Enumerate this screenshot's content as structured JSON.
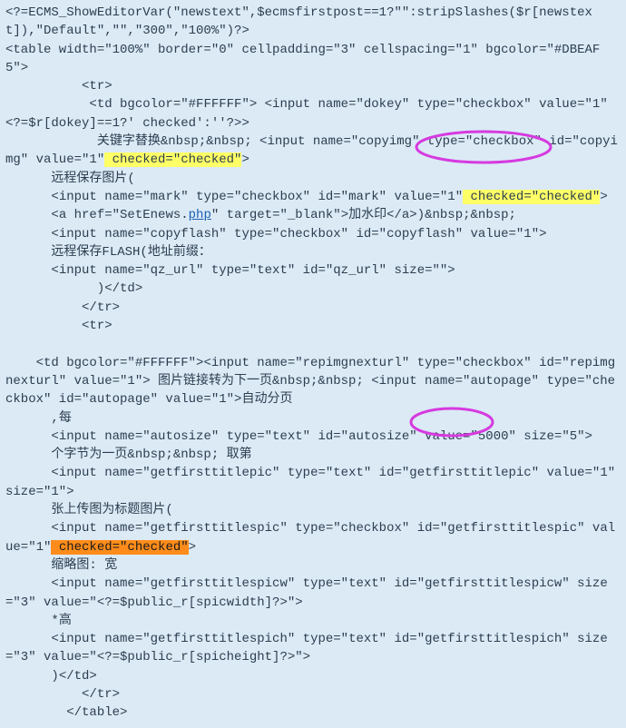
{
  "code": {
    "l01": "<?=ECMS_ShowEditorVar(\"newstext\",$ecmsfirstpost==1?\"\":stripSlashes($r[newstext]),\"Default\",\"\",\"300\",\"100%\")?>",
    "l02": "<table width=\"100%\" border=\"0\" cellpadding=\"3\" cellspacing=\"1\" bgcolor=\"#DBEAF5\">",
    "l03": "          <tr>",
    "l04a": "           <td bgcolor=\"#FFFFFF\"> <input name=\"dokey\" type=\"checkbox\" value=\"1\"<?=$r[dokey]==1?' checked':''?>>",
    "l05a": "            关键字替换&nbsp;&nbsp; <input name=\"copyimg\" type=\"checkbox\" id=\"copyimg\" value=\"1\"",
    "l05b": " checked=\"checked\"",
    "l05c": ">",
    "l06": "      远程保存图片(",
    "l07a": "      <input name=\"mark\" type=\"checkbox\" id=\"mark\" value=\"1\"",
    "l07b": " checked=\"checked\"",
    "l07c": ">",
    "l08a": "      <a href=\"SetEnews.",
    "l08b": "php",
    "l08c": "\" target=\"_blank\">加水印</a>)&nbsp;&nbsp;",
    "l09": "      <input name=\"copyflash\" type=\"checkbox\" id=\"copyflash\" value=\"1\">",
    "l10": "      远程保存FLASH(地址前缀：",
    "l11": "      <input name=\"qz_url\" type=\"text\" id=\"qz_url\" size=\"\">",
    "l12": "            )</td>",
    "l13": "          </tr>",
    "l14": "          <tr>",
    "l15": "",
    "l16": "    <td bgcolor=\"#FFFFFF\"><input name=\"repimgnexturl\" type=\"checkbox\" id=\"repimgnexturl\" value=\"1\"> 图片链接转为下一页&nbsp;&nbsp; <input name=\"autopage\" type=\"checkbox\" id=\"autopage\" value=\"1\">自动分页",
    "l17": "      ,每",
    "l18": "      <input name=\"autosize\" type=\"text\" id=\"autosize\" value=\"5000\" size=\"5\">",
    "l19": "      个字节为一页&nbsp;&nbsp; 取第",
    "l20": "      <input name=\"getfirsttitlepic\" type=\"text\" id=\"getfirsttitlepic\" value=\"1\" size=\"1\">",
    "l21": "      张上传图为标题图片(",
    "l22a": "      <input name=\"getfirsttitlespic\" type=\"checkbox\" id=\"getfirsttitlespic\"",
    "l22b": " value=\"1\"",
    "l22c": " checked=\"checked\"",
    "l22d": ">",
    "l23": "      缩略图: 宽",
    "l24": "      <input name=\"getfirsttitlespicw\" type=\"text\" id=\"getfirsttitlespicw\" size=\"3\" value=\"<?=$public_r[spicwidth]?>\">",
    "l25": "      *高",
    "l26": "      <input name=\"getfirsttitlespich\" type=\"text\" id=\"getfirsttitlespich\" size=\"3\" value=\"<?=$public_r[spicheight]?>\">",
    "l27": "      )</td>",
    "l28": "          </tr>",
    "l29": "        </table>"
  }
}
